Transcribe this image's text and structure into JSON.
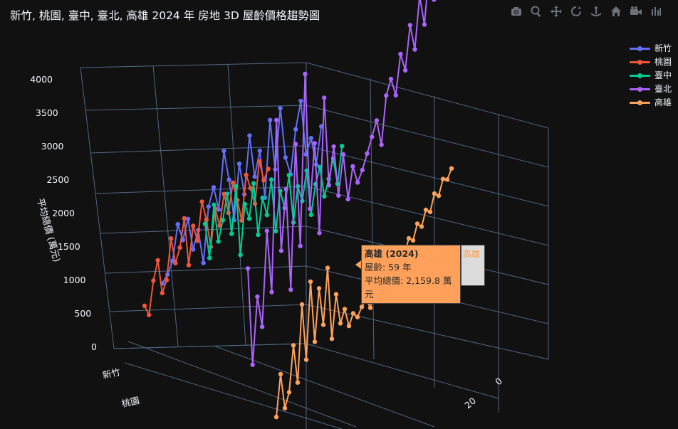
{
  "title": "新竹, 桃園, 臺中, 臺北, 高雄 2024 年 房地  3D 屋齡價格趨勢圖",
  "modebar": [
    "camera-icon",
    "zoom-icon",
    "pan-icon",
    "orbit-icon",
    "turntable-icon",
    "home-icon",
    "camera-view-icon",
    "plotly-logo-icon"
  ],
  "legend": [
    {
      "name": "新竹",
      "color": "#636efa"
    },
    {
      "name": "桃園",
      "color": "#ef553b"
    },
    {
      "name": "臺中",
      "color": "#00cc96"
    },
    {
      "name": "臺北",
      "color": "#ab63fa"
    },
    {
      "name": "高雄",
      "color": "#ffa15a"
    }
  ],
  "hover": {
    "title": "高雄 (2024)",
    "line1": "屋齡: 59 年",
    "line2": "平均總價: 2,159.8 萬元",
    "tag": "高雄"
  },
  "chart_data": {
    "type": "line",
    "title": "新竹, 桃園, 臺中, 臺北, 高雄 2024 年 房地  3D 屋齡價格趨勢圖",
    "zlabel": "平均總價 (萬元)",
    "zticks": [
      "0",
      "500",
      "1000",
      "1500",
      "2000",
      "2500",
      "3000",
      "3500",
      "4000"
    ],
    "zlim": [
      0,
      4000
    ],
    "yticks": [
      "新竹",
      "桃園"
    ],
    "xticks": [
      "0",
      "20"
    ],
    "series": [
      {
        "name": "新竹",
        "color": "#636efa",
        "points": [
          [
            0,
            450
          ],
          [
            1,
            560
          ],
          [
            2,
            730
          ],
          [
            3,
            1180
          ],
          [
            4,
            990
          ],
          [
            5,
            1250
          ],
          [
            6,
            880
          ],
          [
            7,
            1120
          ],
          [
            8,
            720
          ],
          [
            9,
            1410
          ],
          [
            10,
            1650
          ],
          [
            11,
            1380
          ],
          [
            12,
            2100
          ],
          [
            13,
            1750
          ],
          [
            14,
            1260
          ],
          [
            15,
            1950
          ],
          [
            16,
            1580
          ],
          [
            17,
            2300
          ],
          [
            18,
            1800
          ],
          [
            19,
            2120
          ],
          [
            20,
            1550
          ],
          [
            21,
            2500
          ],
          [
            22,
            1900
          ],
          [
            23,
            2650
          ],
          [
            24,
            2050
          ],
          [
            25,
            1850
          ],
          [
            26,
            2400
          ],
          [
            27,
            2750
          ],
          [
            28,
            2100
          ],
          [
            29,
            2300
          ],
          [
            30,
            1980
          ],
          [
            31,
            2450
          ]
        ]
      },
      {
        "name": "桃園",
        "color": "#ef553b",
        "points": [
          [
            0,
            350
          ],
          [
            1,
            230
          ],
          [
            2,
            640
          ],
          [
            3,
            880
          ],
          [
            4,
            470
          ],
          [
            5,
            620
          ],
          [
            6,
            1120
          ],
          [
            7,
            810
          ],
          [
            8,
            990
          ],
          [
            9,
            1340
          ],
          [
            10,
            760
          ],
          [
            11,
            1230
          ],
          [
            12,
            1040
          ],
          [
            13,
            1510
          ],
          [
            14,
            1280
          ],
          [
            15,
            940
          ],
          [
            16,
            1400
          ],
          [
            17,
            1180
          ],
          [
            18,
            1560
          ],
          [
            19,
            1320
          ],
          [
            20,
            1680
          ],
          [
            21,
            1460
          ],
          [
            22,
            1200
          ],
          [
            23,
            1750
          ],
          [
            24,
            1580
          ],
          [
            25,
            1380
          ],
          [
            26,
            1890
          ],
          [
            27,
            1650
          ],
          [
            28,
            1780
          ]
        ]
      },
      {
        "name": "臺中",
        "color": "#00cc96",
        "points": [
          [
            0,
            830
          ],
          [
            1,
            420
          ],
          [
            2,
            1080
          ],
          [
            3,
            640
          ],
          [
            4,
            910
          ],
          [
            5,
            1240
          ],
          [
            6,
            760
          ],
          [
            7,
            1350
          ],
          [
            8,
            520
          ],
          [
            9,
            1150
          ],
          [
            10,
            980
          ],
          [
            11,
            1420
          ],
          [
            12,
            800
          ],
          [
            13,
            1260
          ],
          [
            14,
            1060
          ],
          [
            15,
            1500
          ],
          [
            16,
            880
          ],
          [
            17,
            1380
          ],
          [
            18,
            1180
          ],
          [
            19,
            1590
          ],
          [
            20,
            1020
          ],
          [
            21,
            1470
          ],
          [
            22,
            1300
          ],
          [
            23,
            1680
          ],
          [
            24,
            1150
          ],
          [
            25,
            1530
          ],
          [
            26,
            1750
          ],
          [
            27,
            1400
          ],
          [
            28,
            1620
          ],
          [
            29,
            1880
          ],
          [
            30,
            1580
          ],
          [
            31,
            2050
          ]
        ]
      },
      {
        "name": "臺北",
        "color": "#ab63fa",
        "points": [
          [
            0,
            1850
          ],
          [
            1,
            620
          ],
          [
            2,
            1400
          ],
          [
            3,
            980
          ],
          [
            4,
            2100
          ],
          [
            5,
            1300
          ],
          [
            6,
            3350
          ],
          [
            7,
            1700
          ],
          [
            8,
            2400
          ],
          [
            9,
            1120
          ],
          [
            10,
            2850
          ],
          [
            11,
            1550
          ],
          [
            12,
            3600
          ],
          [
            13,
            1900
          ],
          [
            14,
            2650
          ],
          [
            15,
            1500
          ],
          [
            16,
            3100
          ],
          [
            17,
            1980
          ],
          [
            18,
            2400
          ],
          [
            19,
            1750
          ],
          [
            20,
            2200
          ],
          [
            21,
            1600
          ],
          [
            22,
            1950
          ],
          [
            23,
            1700
          ],
          [
            24,
            1800
          ],
          [
            25,
            1950
          ],
          [
            26,
            2100
          ],
          [
            27,
            2250
          ],
          [
            28,
            1900
          ],
          [
            29,
            2450
          ],
          [
            30,
            2600
          ],
          [
            31,
            2350
          ],
          [
            32,
            2800
          ],
          [
            33,
            2550
          ],
          [
            34,
            3050
          ],
          [
            35,
            2700
          ],
          [
            36,
            3300
          ],
          [
            37,
            2900
          ],
          [
            38,
            3500
          ],
          [
            39,
            3100
          ],
          [
            40,
            3750
          ],
          [
            41,
            3250
          ],
          [
            42,
            3950
          ],
          [
            43,
            3450
          ],
          [
            44,
            4000
          ]
        ]
      },
      {
        "name": "高雄",
        "color": "#ffa15a",
        "points": [
          [
            0,
            120
          ],
          [
            1,
            620
          ],
          [
            2,
            180
          ],
          [
            3,
            350
          ],
          [
            4,
            900
          ],
          [
            5,
            420
          ],
          [
            6,
            1350
          ],
          [
            7,
            650
          ],
          [
            8,
            1580
          ],
          [
            9,
            820
          ],
          [
            10,
            1450
          ],
          [
            11,
            980
          ],
          [
            12,
            1650
          ],
          [
            13,
            760
          ],
          [
            14,
            1280
          ],
          [
            15,
            900
          ],
          [
            16,
            1050
          ],
          [
            17,
            820
          ],
          [
            18,
            950
          ],
          [
            19,
            880
          ],
          [
            20,
            980
          ],
          [
            21,
            1050
          ],
          [
            22,
            920
          ],
          [
            23,
            1120
          ],
          [
            24,
            1050
          ],
          [
            25,
            1200
          ],
          [
            26,
            1150
          ],
          [
            27,
            1300
          ],
          [
            28,
            1280
          ],
          [
            29,
            1420
          ],
          [
            30,
            1380
          ],
          [
            31,
            1550
          ],
          [
            32,
            1500
          ],
          [
            33,
            1680
          ],
          [
            34,
            1620
          ],
          [
            35,
            1800
          ],
          [
            36,
            1750
          ],
          [
            37,
            1950
          ],
          [
            38,
            1900
          ],
          [
            39,
            2080
          ],
          [
            40,
            2050
          ],
          [
            41,
            2159.8
          ]
        ]
      }
    ]
  }
}
